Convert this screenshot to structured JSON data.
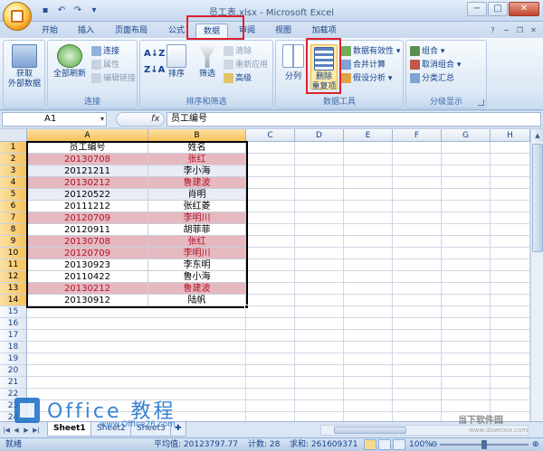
{
  "window": {
    "title": "员工表.xlsx - Microsoft Excel",
    "controls": {
      "minimize": "−",
      "maximize": "□",
      "close": "✕"
    }
  },
  "quick_access": [
    "save-icon",
    "undo-icon",
    "redo-icon",
    "customize-icon"
  ],
  "tabs": [
    "开始",
    "插入",
    "页面布局",
    "公式",
    "数据",
    "审阅",
    "视图",
    "加载项"
  ],
  "active_tab": "数据",
  "ribbon": {
    "groups": {
      "external": {
        "label": "获取\n外部数据",
        "btn1": "获取",
        "btn2": "外部数据"
      },
      "connections": {
        "label": "连接",
        "refresh1": "全部刷新",
        "connections": "连接",
        "properties": "属性",
        "edit_links": "编辑链接"
      },
      "sort_filter": {
        "label": "排序和筛选",
        "sort": "排序",
        "filter": "筛选",
        "clear": "清除",
        "reapply": "重新应用",
        "advanced": "高级"
      },
      "data_tools": {
        "label": "数据工具",
        "split": "分列",
        "remove1": "删除",
        "remove2": "重复项",
        "validation": "数据有效性",
        "consolidate": "合并计算",
        "whatif": "假设分析"
      },
      "outline": {
        "label": "分级显示",
        "group": "组合",
        "ungroup": "取消组合",
        "subtotal": "分类汇总"
      }
    }
  },
  "formula_bar": {
    "name_box": "A1",
    "fx": "fx",
    "formula": "员工编号"
  },
  "columns": [
    "A",
    "B",
    "C",
    "D",
    "E",
    "F",
    "G",
    "H"
  ],
  "row_numbers": [
    "1",
    "2",
    "3",
    "4",
    "5",
    "6",
    "7",
    "8",
    "9",
    "10",
    "11",
    "12",
    "13",
    "14",
    "15",
    "16",
    "17",
    "18",
    "19",
    "20",
    "21",
    "22",
    "23",
    "24"
  ],
  "rows": [
    {
      "a": "员工编号",
      "b": "姓名",
      "style": "head"
    },
    {
      "a": "20130708",
      "b": "张红",
      "style": "hl"
    },
    {
      "a": "20121211",
      "b": "李小海",
      "style": "alt"
    },
    {
      "a": "20130212",
      "b": "鲁建波",
      "style": "hl"
    },
    {
      "a": "20120522",
      "b": "肖明",
      "style": "alt"
    },
    {
      "a": "20111212",
      "b": "张红菱",
      "style": "plain"
    },
    {
      "a": "20120709",
      "b": "李明川",
      "style": "hl"
    },
    {
      "a": "20120911",
      "b": "胡菲菲",
      "style": "plain"
    },
    {
      "a": "20130708",
      "b": "张红",
      "style": "hl"
    },
    {
      "a": "20120709",
      "b": "李明川",
      "style": "hl"
    },
    {
      "a": "20130923",
      "b": "李东明",
      "style": "plain"
    },
    {
      "a": "20110422",
      "b": "鲁小海",
      "style": "plain"
    },
    {
      "a": "20130212",
      "b": "鲁建波",
      "style": "hl"
    },
    {
      "a": "20130912",
      "b": "陆帆",
      "style": "plain"
    }
  ],
  "colors": {
    "highlight_bg": "#e6b8c0",
    "highlight_text": "#b01426",
    "accent": "#e0202c"
  },
  "sheets": [
    "Sheet1",
    "Sheet2",
    "Sheet3"
  ],
  "active_sheet": "Sheet1",
  "status": {
    "mode": "就绪",
    "average": "平均值: 20123797.77",
    "count": "计数: 28",
    "sum": "求和: 261609371",
    "zoom": "100%"
  },
  "watermark": "Office 教程",
  "watermark_sub": "www.Office26.com",
  "logo_text": "当下软件园"
}
